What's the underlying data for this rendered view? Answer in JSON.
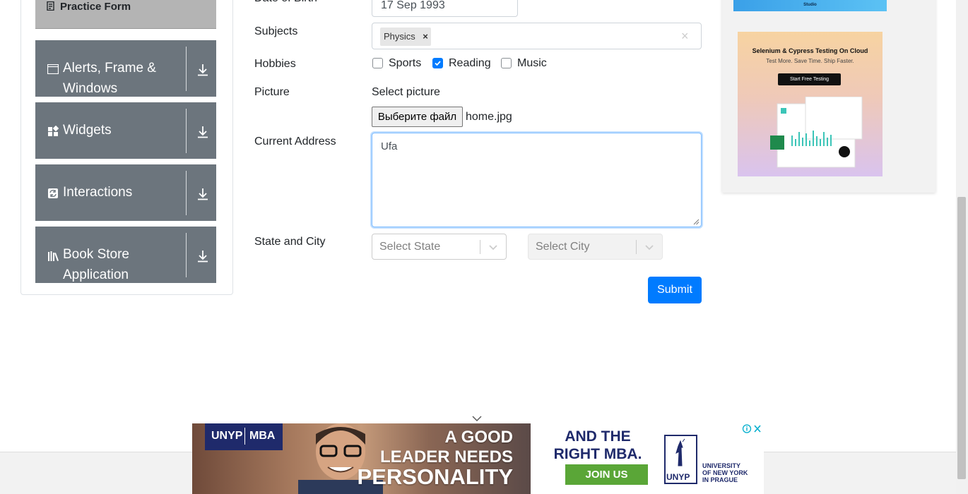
{
  "sidebar": {
    "practice_form": "Practice Form",
    "groups": [
      {
        "label_line1": "Alerts, Frame &",
        "label_line2": "Windows",
        "icon": "window-icon"
      },
      {
        "label_line1": "Widgets",
        "label_line2": "",
        "icon": "widgets-icon"
      },
      {
        "label_line1": "Interactions",
        "label_line2": "",
        "icon": "interactions-icon"
      },
      {
        "label_line1": "Book Store",
        "label_line2": "Application",
        "icon": "book-icon"
      }
    ]
  },
  "form": {
    "dob_label": "Date of Birth",
    "dob_value": "17 Sep 1993",
    "subjects_label": "Subjects",
    "subject_chip": "Physics",
    "subject_chip_remove": "×",
    "subjects_clear": "×",
    "hobbies_label": "Hobbies",
    "hobbies": [
      {
        "label": "Sports",
        "checked": false
      },
      {
        "label": "Reading",
        "checked": true
      },
      {
        "label": "Music",
        "checked": false
      }
    ],
    "picture_label": "Picture",
    "select_picture": "Select picture",
    "file_button": "Выберите файл",
    "file_name": "home.jpg",
    "address_label": "Current Address",
    "address_value": "Ufa",
    "state_city_label": "State and City",
    "state_placeholder": "Select State",
    "city_placeholder": "Select City",
    "submit": "Submit"
  },
  "ad_right": {
    "strip_text": "Studio",
    "title": "Selenium & Cypress Testing On Cloud",
    "subtitle": "Test More. Save Time. Ship Faster.",
    "button": "Start Free Testing"
  },
  "ad_bottom": {
    "logo_left": "UNYP",
    "logo_right": "MBA",
    "slogan_1": "A GOOD",
    "slogan_2": "LEADER NEEDS",
    "slogan_3": "PERSONALITY",
    "and_text_1": "AND THE",
    "and_text_2": "RIGHT MBA.",
    "join": "JOIN US",
    "unyp_small": "UNYP",
    "univ_1": "UNIVERSITY",
    "univ_2": "OF NEW YORK",
    "univ_3": "IN PRAGUE"
  },
  "colors": {
    "primary": "#007bff",
    "sidebar_group": "#6c757d",
    "sidebar_active": "#b4b4b4"
  }
}
